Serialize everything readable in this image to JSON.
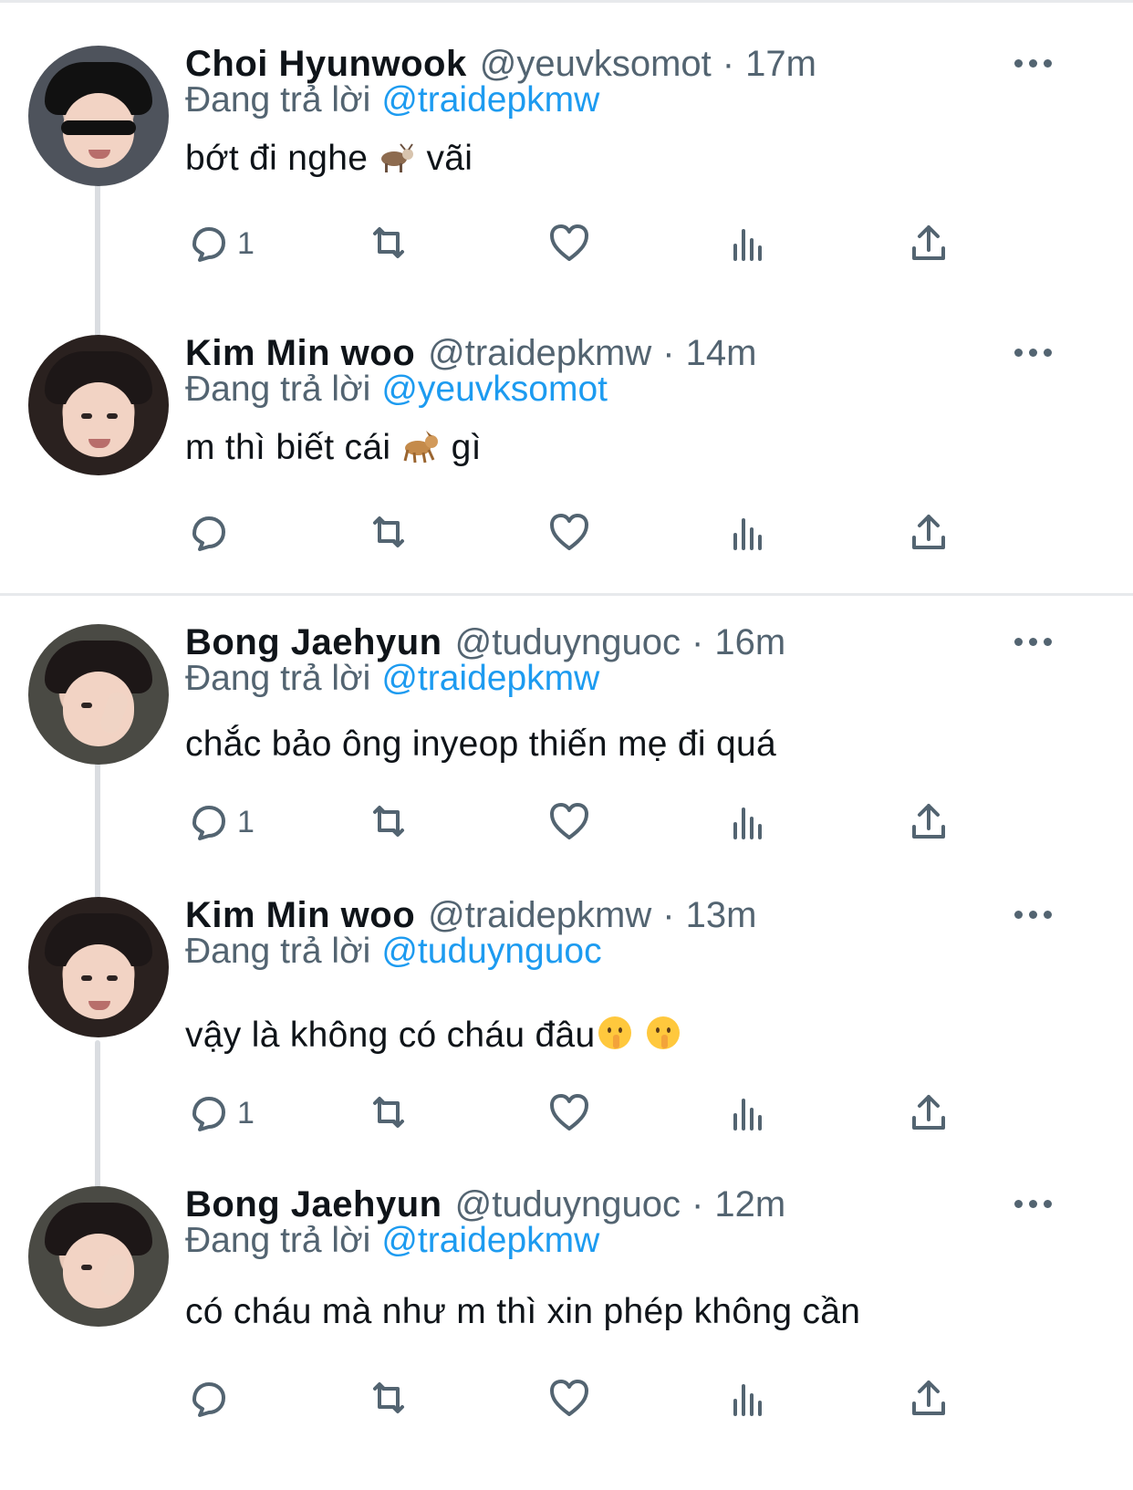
{
  "tweets": [
    {
      "name": "Choi Hyunwook",
      "handle": "@yeuvksomot",
      "time": "17m",
      "reply_label": "Đang trả lời",
      "reply_to": "@traidepkmw",
      "text_before": "bớt đi nghe",
      "emoji": "goat",
      "text_after": "vãi",
      "reply_count": "1"
    },
    {
      "name": "Kim Min woo",
      "handle": "@traidepkmw",
      "time": "14m",
      "reply_label": "Đang trả lời",
      "reply_to": "@yeuvksomot",
      "text_before": "m thì biết cái",
      "emoji": "dog",
      "text_after": "gì",
      "reply_count": ""
    },
    {
      "name": "Bong Jaehyun",
      "handle": "@tuduynguoc",
      "time": "16m",
      "reply_label": "Đang trả lời",
      "reply_to": "@traidepkmw",
      "text": "chắc bảo ông inyeop thiến mẹ đi quá",
      "reply_count": "1"
    },
    {
      "name": "Kim Min woo",
      "handle": "@traidepkmw",
      "time": "13m",
      "reply_label": "Đang trả lời",
      "reply_to": "@tuduynguoc",
      "text": "vậy là không có cháu đâu",
      "emoji": "shushing-face",
      "emoji_count": 2,
      "reply_count": "1"
    },
    {
      "name": "Bong Jaehyun",
      "handle": "@tuduynguoc",
      "time": "12m",
      "reply_label": "Đang trả lời",
      "reply_to": "@traidepkmw",
      "text": "có cháu mà như m thì xin phép không cần",
      "reply_count": ""
    }
  ],
  "dot": "·",
  "icons": {
    "reply": "reply-icon",
    "retweet": "retweet-icon",
    "like": "heart-icon",
    "views": "views-icon",
    "share": "share-icon",
    "more": "more-icon"
  },
  "colors": {
    "text": "#0f1419",
    "secondary": "#536471",
    "link": "#1d9bf0",
    "divider": "#e7e9ec",
    "thread": "#dadde1"
  }
}
